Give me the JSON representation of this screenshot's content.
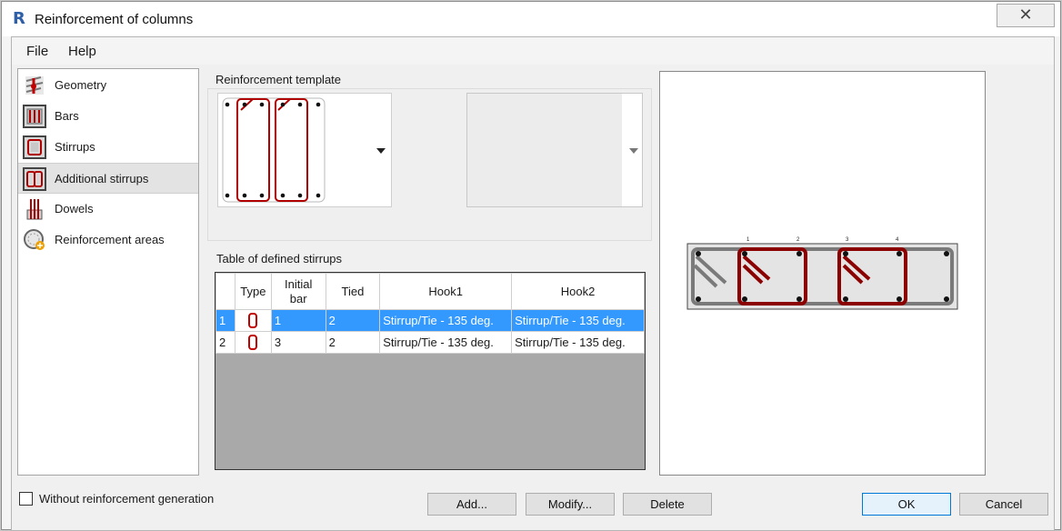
{
  "window": {
    "title": "Reinforcement of columns",
    "app_icon": "R",
    "close_glyph": "✕"
  },
  "menu": {
    "file": "File",
    "help": "Help"
  },
  "nav": {
    "items": [
      {
        "label": "Geometry",
        "icon": "geometry-icon"
      },
      {
        "label": "Bars",
        "icon": "bars-icon"
      },
      {
        "label": "Stirrups",
        "icon": "stirrups-icon"
      },
      {
        "label": "Additional stirrups",
        "icon": "additional-stirrups-icon"
      },
      {
        "label": "Dowels",
        "icon": "dowels-icon"
      },
      {
        "label": "Reinforcement areas",
        "icon": "reinforcement-areas-icon"
      }
    ],
    "selected": "Additional stirrups"
  },
  "template": {
    "label": "Reinforcement template"
  },
  "stirrups_table": {
    "label": "Table of defined stirrups",
    "headers": {
      "type": "Type",
      "initial_bar": "Initial\nbar",
      "tied": "Tied",
      "hook1": "Hook1",
      "hook2": "Hook2"
    },
    "rows": [
      {
        "num": "1",
        "initial_bar": "1",
        "tied": "2",
        "hook1": "Stirrup/Tie - 135 deg.",
        "hook2": "Stirrup/Tie - 135 deg."
      },
      {
        "num": "2",
        "initial_bar": "3",
        "tied": "2",
        "hook1": "Stirrup/Tie - 135 deg.",
        "hook2": "Stirrup/Tie - 135 deg."
      }
    ]
  },
  "preview": {
    "bar_numbers": [
      "1",
      "2",
      "3",
      "4"
    ]
  },
  "options": {
    "without_generation": "Without reinforcement generation"
  },
  "buttons": {
    "add": "Add...",
    "modify": "Modify...",
    "delete": "Delete",
    "ok": "OK",
    "cancel": "Cancel"
  },
  "colors": {
    "stirrup": "#a40000",
    "selection": "#3399ff"
  }
}
